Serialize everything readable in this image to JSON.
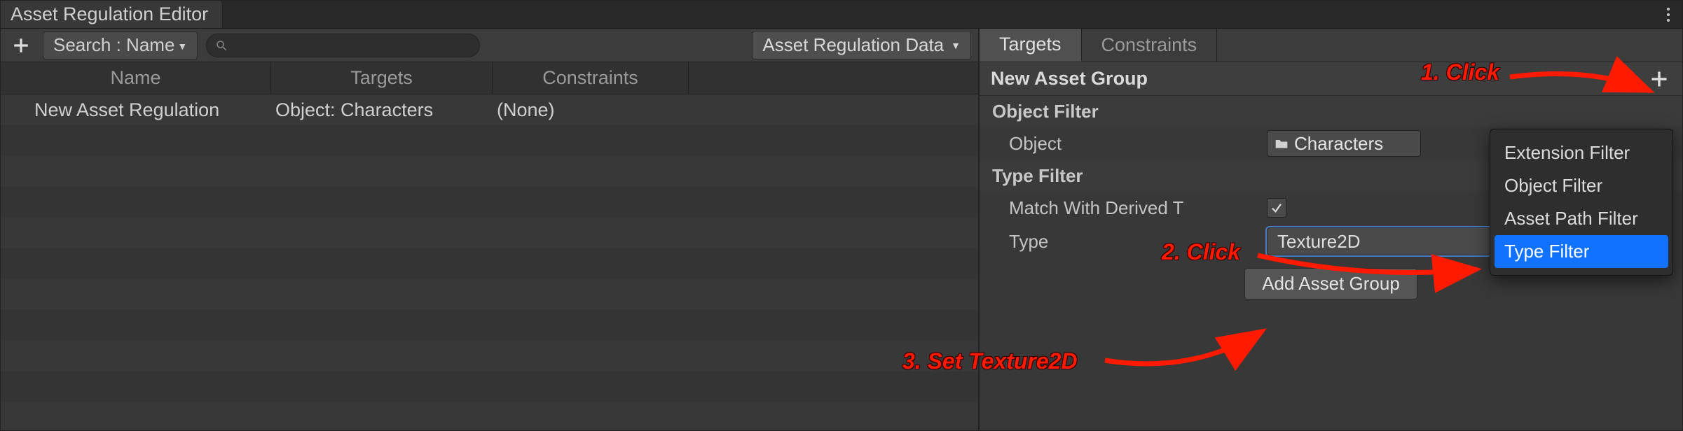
{
  "window": {
    "title": "Asset Regulation Editor"
  },
  "toolbar": {
    "search_mode_label": "Search : Name",
    "search_placeholder": "",
    "data_dropdown_label": "Asset Regulation Data"
  },
  "columns": {
    "name": "Name",
    "targets": "Targets",
    "constraints": "Constraints"
  },
  "rows": [
    {
      "name": "New Asset Regulation",
      "targets": "Object: Characters",
      "constraints": "(None)"
    }
  ],
  "right": {
    "tabs": {
      "targets": "Targets",
      "constraints": "Constraints"
    },
    "group_title": "New Asset Group",
    "sections": {
      "object_filter": {
        "title": "Object Filter",
        "object_label": "Object",
        "object_value": "Characters"
      },
      "type_filter": {
        "title": "Type Filter",
        "match_derived_label": "Match With Derived T",
        "match_derived_checked": true,
        "type_label": "Type",
        "type_value": "Texture2D"
      }
    },
    "add_group_button": "Add Asset Group"
  },
  "filter_menu": {
    "items": [
      "Extension Filter",
      "Object Filter",
      "Asset Path Filter",
      "Type Filter"
    ],
    "selected_index": 3
  },
  "annotations": {
    "step1": "1. Click",
    "step2": "2. Click",
    "step3": "3. Set Texture2D"
  }
}
